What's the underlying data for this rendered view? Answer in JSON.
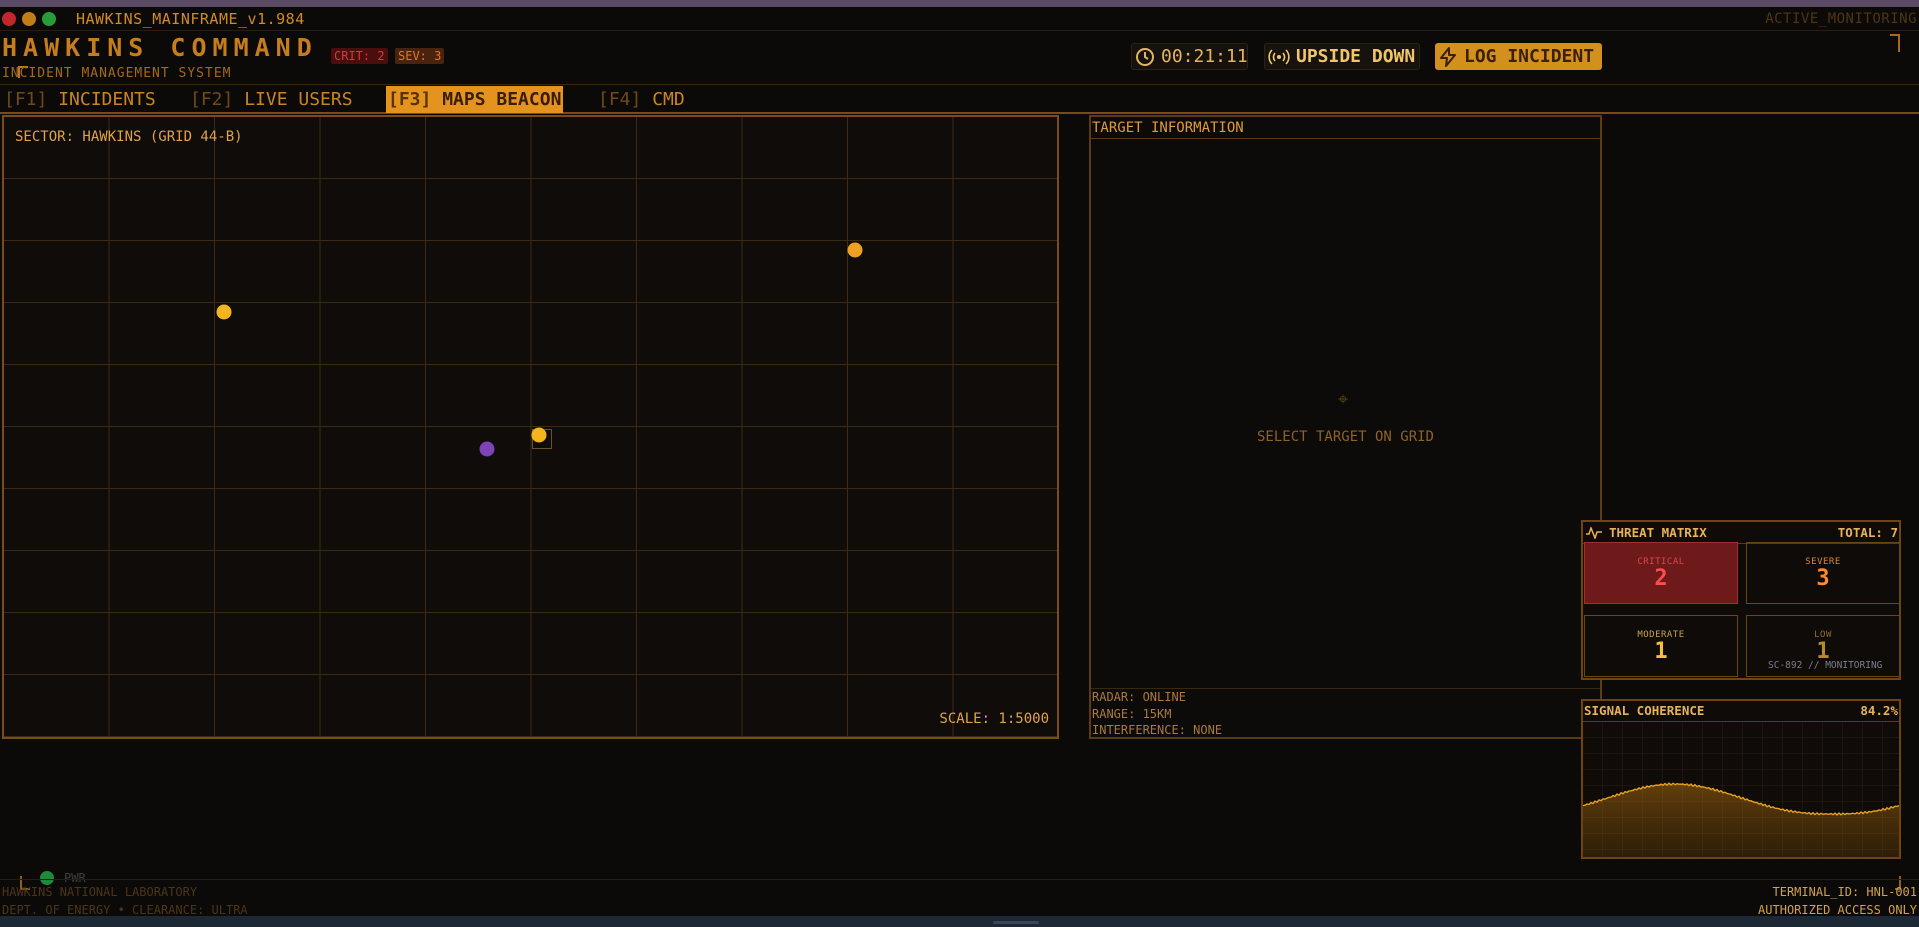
{
  "window": {
    "title": "HAWKINS_MAINFRAME_v1.984",
    "status": "ACTIVE_MONITORING"
  },
  "header": {
    "brand": "HAWKINS COMMAND",
    "subtitle": "INCIDENT MANAGEMENT SYSTEM",
    "crit_badge": "CRIT: 2",
    "sev_badge": "SEV: 3",
    "timer": "00:21:11",
    "timer_icon": "clock-icon",
    "mode_label": "UPSIDE DOWN",
    "mode_icon": "broadcast-icon",
    "log_label": "LOG INCIDENT",
    "log_icon": "lightning-icon"
  },
  "tabs": [
    {
      "key": "[F1]",
      "label": "INCIDENTS",
      "active": false
    },
    {
      "key": "[F2]",
      "label": "LIVE USERS",
      "active": false
    },
    {
      "key": "[F3]",
      "label": "MAPS BEACON",
      "active": true
    },
    {
      "key": "[F4]",
      "label": "CMD",
      "active": false
    }
  ],
  "map": {
    "sector": "SECTOR: HAWKINS (GRID 44-B)",
    "scale": "SCALE: 1:5000",
    "blip_colors": {
      "orange": "#f0a020",
      "gold": "#f2b51e",
      "purple": "#7c44b8"
    }
  },
  "target": {
    "title": "TARGET INFORMATION",
    "prompt": "SELECT TARGET ON GRID",
    "radar": "RADAR: ONLINE",
    "range": "RANGE: 15KM",
    "interference": "INTERFERENCE: NONE"
  },
  "threat_matrix": {
    "title": "THREAT MATRIX",
    "total": "TOTAL: 7",
    "icon": "pulse-icon",
    "critical": {
      "label": "CRITICAL",
      "count": "2"
    },
    "severe": {
      "label": "SEVERE",
      "count": "3"
    },
    "moderate": {
      "label": "MODERATE",
      "count": "1"
    },
    "low": {
      "label": "LOW",
      "count": "1"
    },
    "monitor_tag": "SC-892 // MONITORING"
  },
  "signal": {
    "title": "SIGNAL COHERENCE",
    "value": "84.2%",
    "accent": "#e8a020"
  },
  "footer": {
    "pwr": "PWR",
    "lab": "HAWKINS NATIONAL LABORATORY",
    "dept": "DEPT. OF ENERGY • CLEARANCE: ULTRA",
    "terminal": "TERMINAL_ID: HNL-001",
    "access": "AUTHORIZED ACCESS ONLY"
  }
}
